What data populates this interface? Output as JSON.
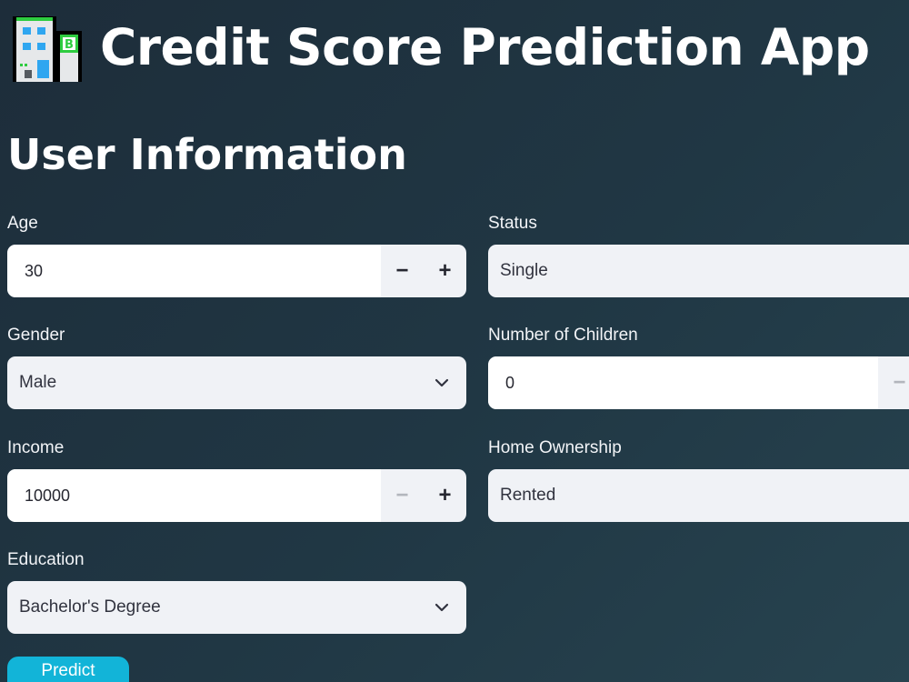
{
  "app": {
    "title": "Credit Score Prediction App",
    "icon": "office-building-emoji"
  },
  "section": {
    "title": "User Information"
  },
  "fields": {
    "age": {
      "label": "Age",
      "value": "30",
      "minus": "−",
      "plus": "+"
    },
    "status": {
      "label": "Status",
      "value": "Single"
    },
    "gender": {
      "label": "Gender",
      "value": "Male"
    },
    "children": {
      "label": "Number of Children",
      "value": "0",
      "minus": "−"
    },
    "income": {
      "label": "Income",
      "value": "10000",
      "minus": "−",
      "plus": "+"
    },
    "home_ownership": {
      "label": "Home Ownership",
      "value": "Rented"
    },
    "education": {
      "label": "Education",
      "value": "Bachelor's Degree"
    }
  },
  "actions": {
    "predict_label": "Predict"
  },
  "colors": {
    "background": "#203744",
    "input_bg": "#f0f2f6",
    "input_text": "#31333f",
    "button": "#12b4d8"
  }
}
